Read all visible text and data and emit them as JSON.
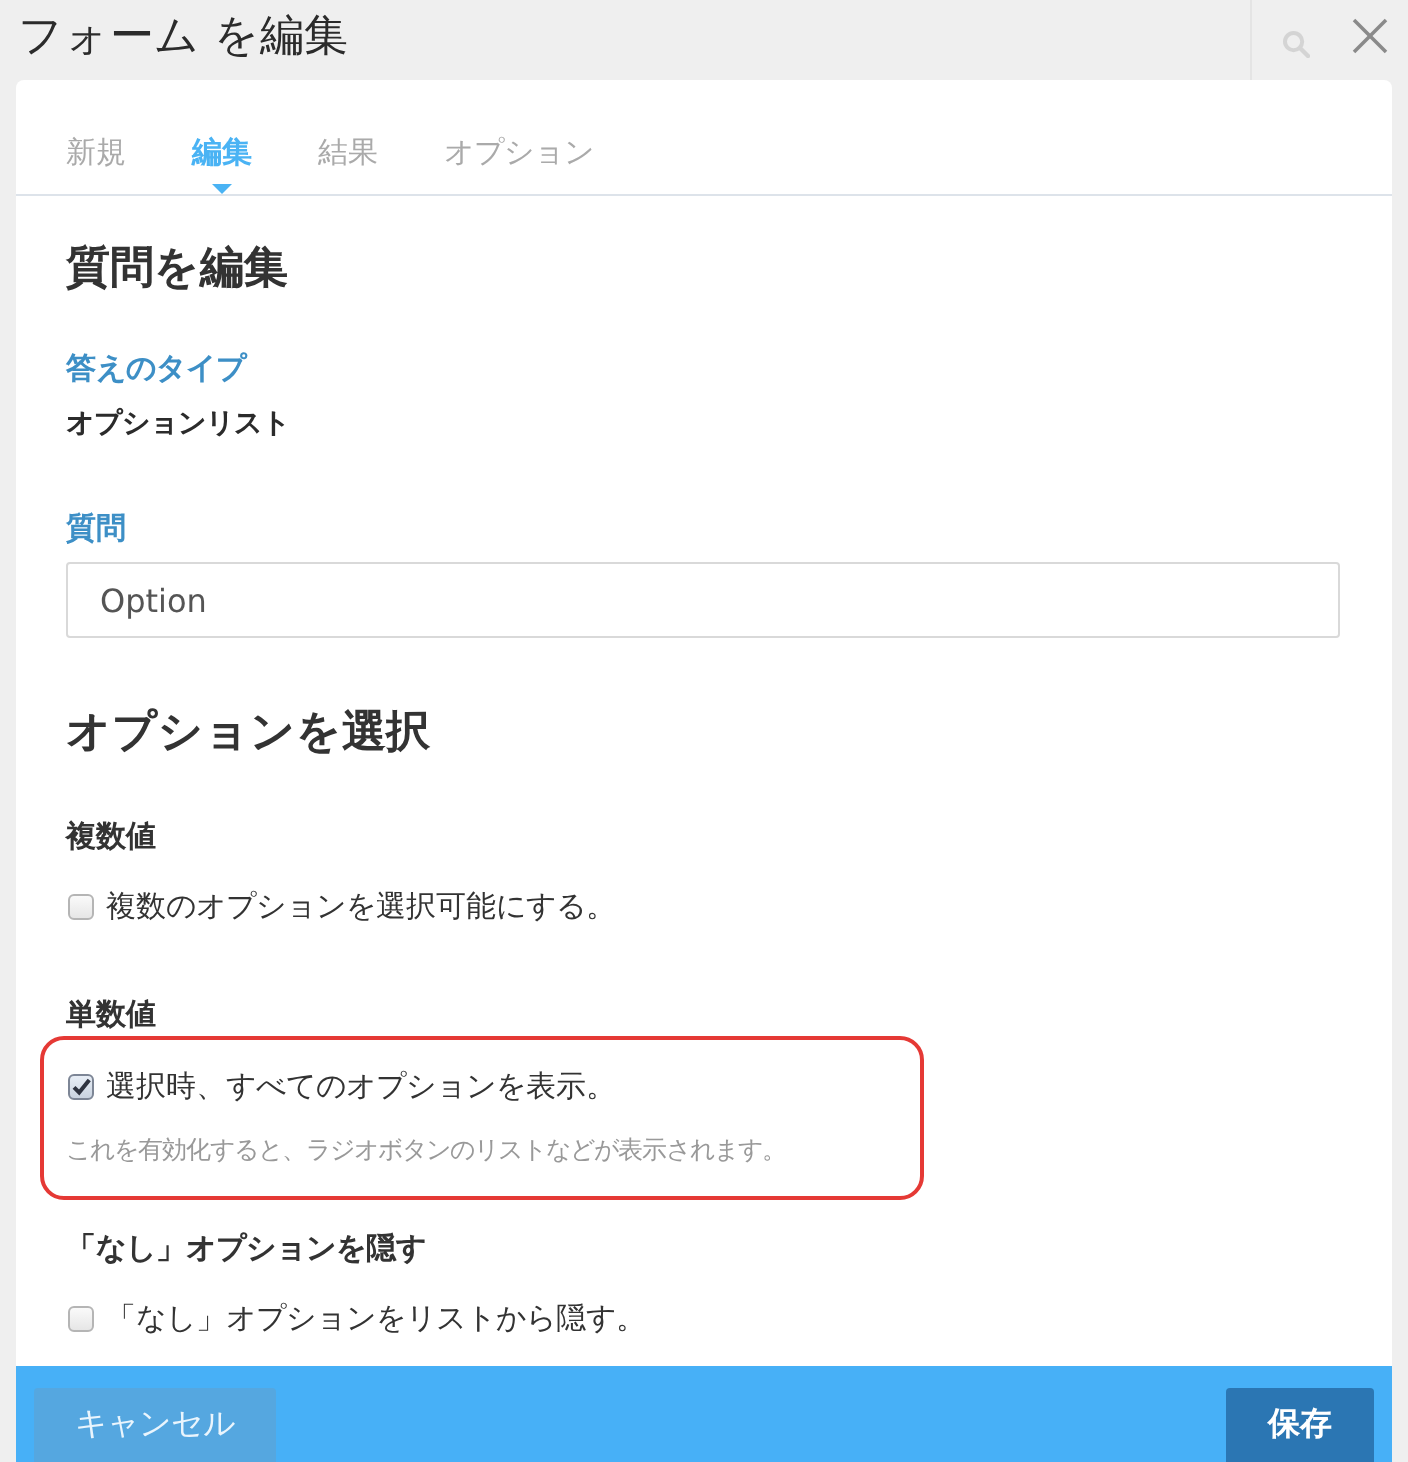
{
  "window": {
    "title": "フォーム を編集"
  },
  "tabs": [
    {
      "label": "新規",
      "selected": false
    },
    {
      "label": "編集",
      "selected": true
    },
    {
      "label": "結果",
      "selected": false
    },
    {
      "label": "オプション",
      "selected": false
    }
  ],
  "section": {
    "title": "質問を編集"
  },
  "answer_type": {
    "label": "答えのタイプ",
    "value": "オプションリスト"
  },
  "question": {
    "label": "質問",
    "value": "Option"
  },
  "options_section": {
    "title": "オプションを選択",
    "groups": [
      {
        "title": "複数値",
        "checkbox": {
          "label": "複数のオプションを選択可能にする。",
          "checked": false
        },
        "highlighted": false
      },
      {
        "title": "単数値",
        "checkbox": {
          "label": "選択時、すべてのオプションを表示。",
          "checked": true
        },
        "hint": "これを有効化すると、ラジオボタンのリストなどが表示されます。",
        "highlighted": true
      },
      {
        "title": "「なし」オプションを隠す",
        "checkbox": {
          "label": "「なし」オプションをリストから隠す。",
          "checked": false
        },
        "highlighted": false
      }
    ]
  },
  "footer": {
    "buttons": [
      {
        "label": "キャンセル",
        "kind": "secondary"
      },
      {
        "label": "保存",
        "kind": "primary"
      }
    ]
  }
}
